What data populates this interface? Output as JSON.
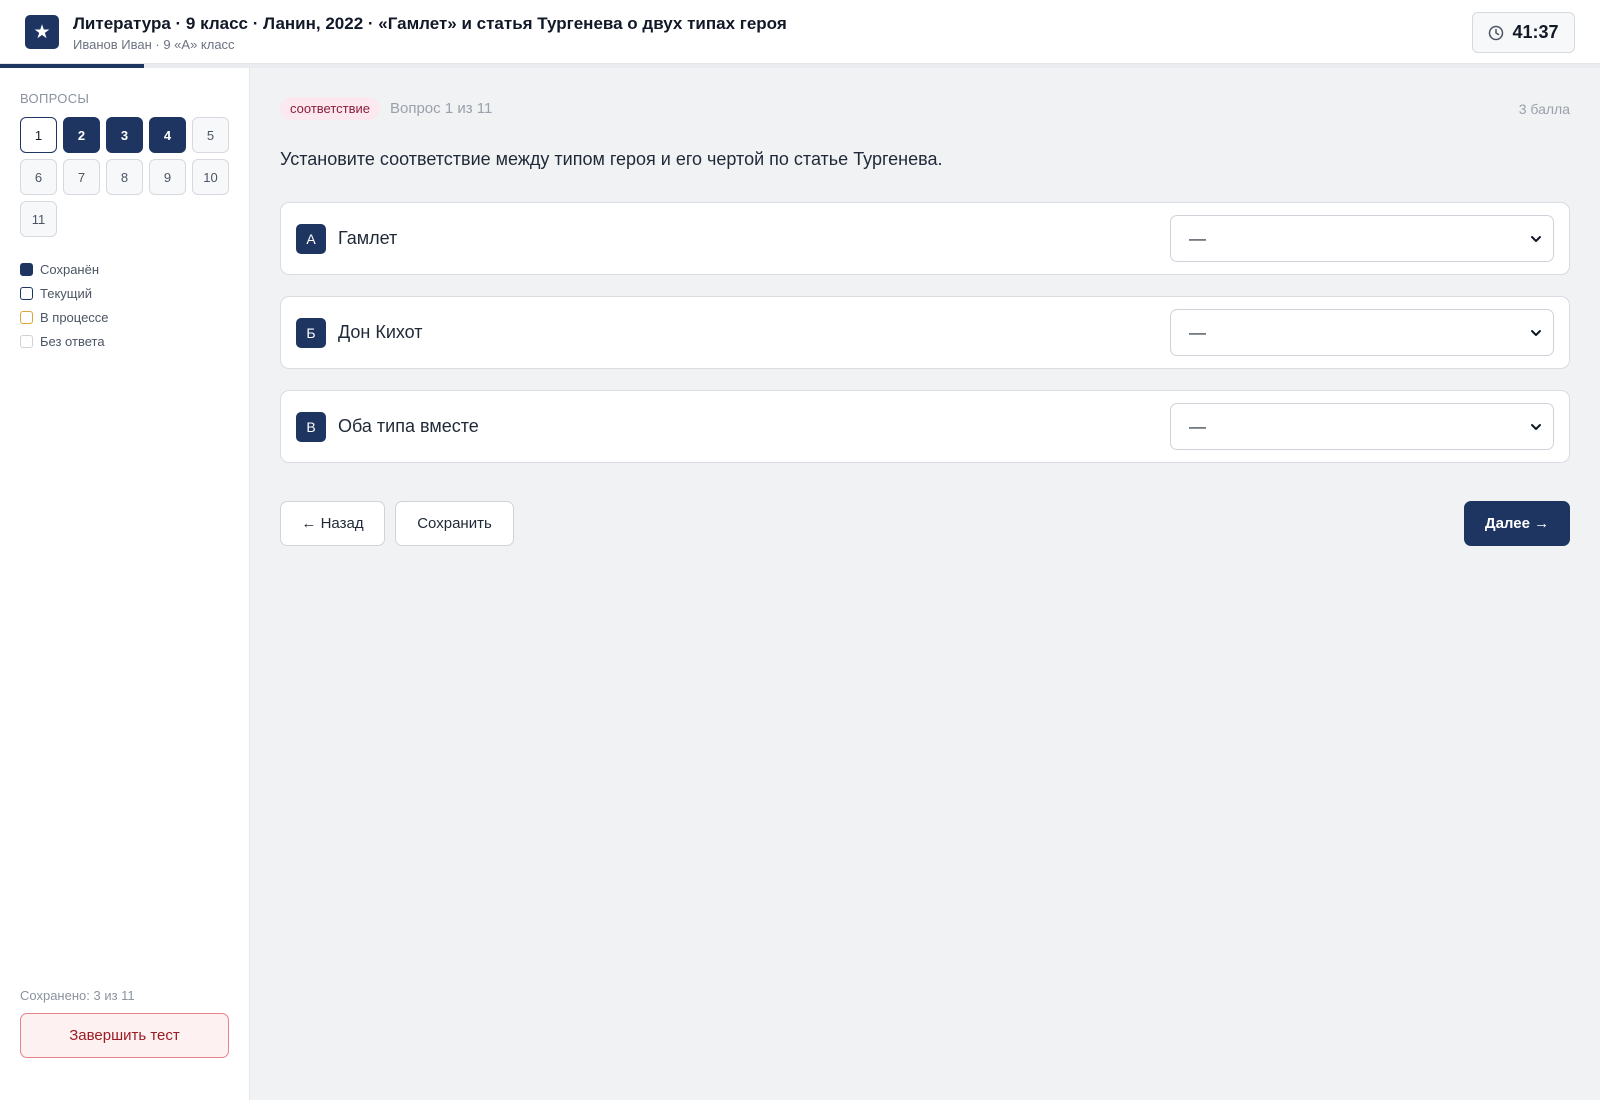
{
  "header": {
    "logo_glyph": "★",
    "title": "Литература · 9 класс · Ланин, 2022 · «Гамлет» и статья Тургенева о двух типах героя",
    "subtitle": "Иванов Иван · 9 «А» класс",
    "timer": "41:37",
    "progress_fraction": 0.09
  },
  "sidebar": {
    "heading": "ВОПРОСЫ",
    "questions": [
      {
        "label": "1",
        "state": "current"
      },
      {
        "label": "2",
        "state": "saved"
      },
      {
        "label": "3",
        "state": "saved"
      },
      {
        "label": "4",
        "state": "saved"
      },
      {
        "label": "5",
        "state": "empty"
      },
      {
        "label": "6",
        "state": "empty"
      },
      {
        "label": "7",
        "state": "empty"
      },
      {
        "label": "8",
        "state": "empty"
      },
      {
        "label": "9",
        "state": "empty"
      },
      {
        "label": "10",
        "state": "empty"
      },
      {
        "label": "11",
        "state": "empty"
      }
    ],
    "legend": [
      {
        "label": "Сохранён",
        "fill": "#1e3461",
        "border": "#1e3461"
      },
      {
        "label": "Текущий",
        "fill": "#ffffff",
        "border": "#1e3461"
      },
      {
        "label": "В процессе",
        "fill": "#ffffff",
        "border": "#e0a43a"
      },
      {
        "label": "Без ответа",
        "fill": "#ffffff",
        "border": "#cfd3d9"
      }
    ],
    "saved_text": "Сохранено: 3 из 11",
    "finish_label": "Завершить тест"
  },
  "question": {
    "type_badge": "соответствие",
    "counter": "Вопрос 1 из 11",
    "points": "3 балла",
    "text": "Установите соответствие между типом героя и его чертой по статье Тургенева.",
    "rows": [
      {
        "letter": "А",
        "label": "Гамлет",
        "selected": "—"
      },
      {
        "letter": "Б",
        "label": "Дон Кихот",
        "selected": "—"
      },
      {
        "letter": "В",
        "label": "Оба типа вместе",
        "selected": "—"
      }
    ]
  },
  "actions": {
    "back_label": "← Назад",
    "save_label": "Сохранить",
    "next_label": "Далее →"
  },
  "colors": {
    "primary": "#1e3461",
    "danger": "#9b1c24",
    "badge_bg": "#fbe9ef"
  }
}
